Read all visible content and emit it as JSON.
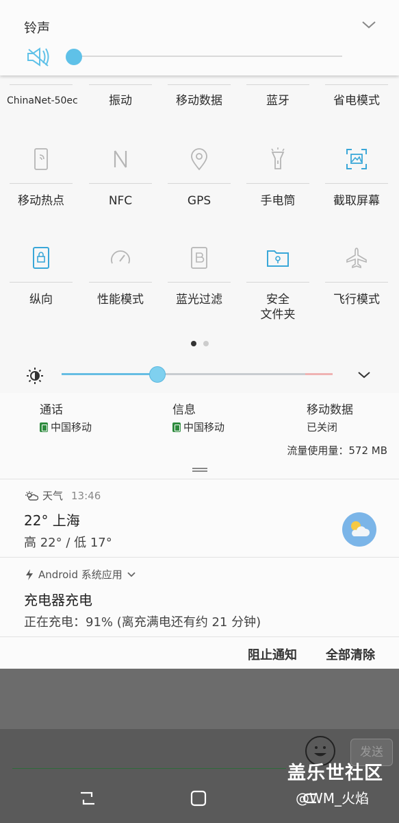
{
  "ringtone": {
    "title": "铃声"
  },
  "tiles_row1_labels": [
    "ChinaNet-50ec",
    "振动",
    "移动数据",
    "蓝牙",
    "省电模式"
  ],
  "tiles": [
    {
      "label": "移动热点",
      "icon": "hotspot-icon",
      "active": false
    },
    {
      "label": "NFC",
      "icon": "nfc-icon",
      "active": false
    },
    {
      "label": "GPS",
      "icon": "location-pin-icon",
      "active": false
    },
    {
      "label": "手电筒",
      "icon": "flashlight-icon",
      "active": false
    },
    {
      "label": "截取屏幕",
      "icon": "screenshot-icon",
      "active": true
    },
    {
      "label": "纵向",
      "icon": "lock-rotation-icon",
      "active": true
    },
    {
      "label": "性能模式",
      "icon": "speedometer-icon",
      "active": false
    },
    {
      "label": "蓝光过滤",
      "icon": "bluelight-filter-icon",
      "active": false
    },
    {
      "label": "安全\n文件夹",
      "icon": "secure-folder-icon",
      "active": true
    },
    {
      "label": "飞行模式",
      "icon": "airplane-icon",
      "active": false
    }
  ],
  "secure_folder_line1": "安全",
  "secure_folder_line2": "文件夹",
  "page_indicator": {
    "current": 1,
    "total": 2
  },
  "brightness_level": 0.35,
  "sim": {
    "call": {
      "title": "通话",
      "carrier": "中国移动"
    },
    "message": {
      "title": "信息",
      "carrier": "中国移动"
    },
    "data": {
      "title": "移动数据",
      "status": "已关闭"
    },
    "usage": "流量使用量：572 MB"
  },
  "weather_notif": {
    "app": "天气",
    "time": "13:46",
    "title": "22° 上海",
    "text": "高 22° / 低 17°"
  },
  "charge_notif": {
    "app": "Android 系统应用",
    "title": "充电器充电",
    "text": "正在充电：91% (离充满电还有约 21 分钟)"
  },
  "actions": {
    "block": "阻止通知",
    "clear_all": "全部清除"
  },
  "background": {
    "send": "发送"
  },
  "watermark": {
    "line1": "盖乐世社区",
    "line2": "@WM_火焰"
  },
  "colors": {
    "accent": "#5fc1e8",
    "active_icon": "#3aa7d8",
    "inactive_icon": "#b5b5b5"
  }
}
